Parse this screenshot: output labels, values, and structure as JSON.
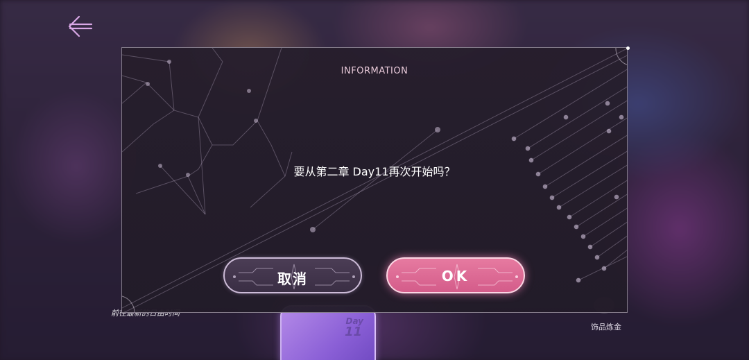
{
  "dialog": {
    "title": "INFORMATION",
    "message": "要从第二章 Day11再次开始吗？",
    "cancel_label": "取消",
    "ok_label": "OK"
  },
  "background": {
    "bottom_left_text": "前往最新的日由时间",
    "day_badge_label": "Day",
    "day_badge_number": "11",
    "bottom_right_text": "饰品炼金"
  },
  "icons": {
    "back": "back-arrow-icon"
  },
  "colors": {
    "accent_pink": "#d45c8a",
    "dialog_bg": "#261e2c",
    "title_color": "#e7c8d8"
  }
}
